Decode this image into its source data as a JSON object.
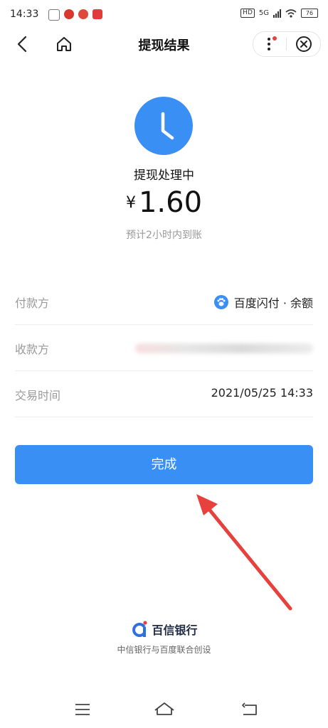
{
  "status_bar": {
    "time": "14:33",
    "network": "5G",
    "hd": "HD",
    "battery": "76"
  },
  "nav": {
    "title": "提现结果"
  },
  "result": {
    "status": "提现处理中",
    "currency_symbol": "¥",
    "amount": "1.60",
    "eta": "预计2小时内到账"
  },
  "details": [
    {
      "label": "付款方",
      "value": "百度闪付 · 余额"
    },
    {
      "label": "收款方",
      "value": ""
    },
    {
      "label": "交易时间",
      "value": "2021/05/25 14:33"
    }
  ],
  "done_button": "完成",
  "footer": {
    "brand_name": "百信银行",
    "brand_sub": "中信银行与百度联合创设"
  },
  "colors": {
    "primary": "#3a8ff5",
    "arrow": "#e8413d"
  }
}
